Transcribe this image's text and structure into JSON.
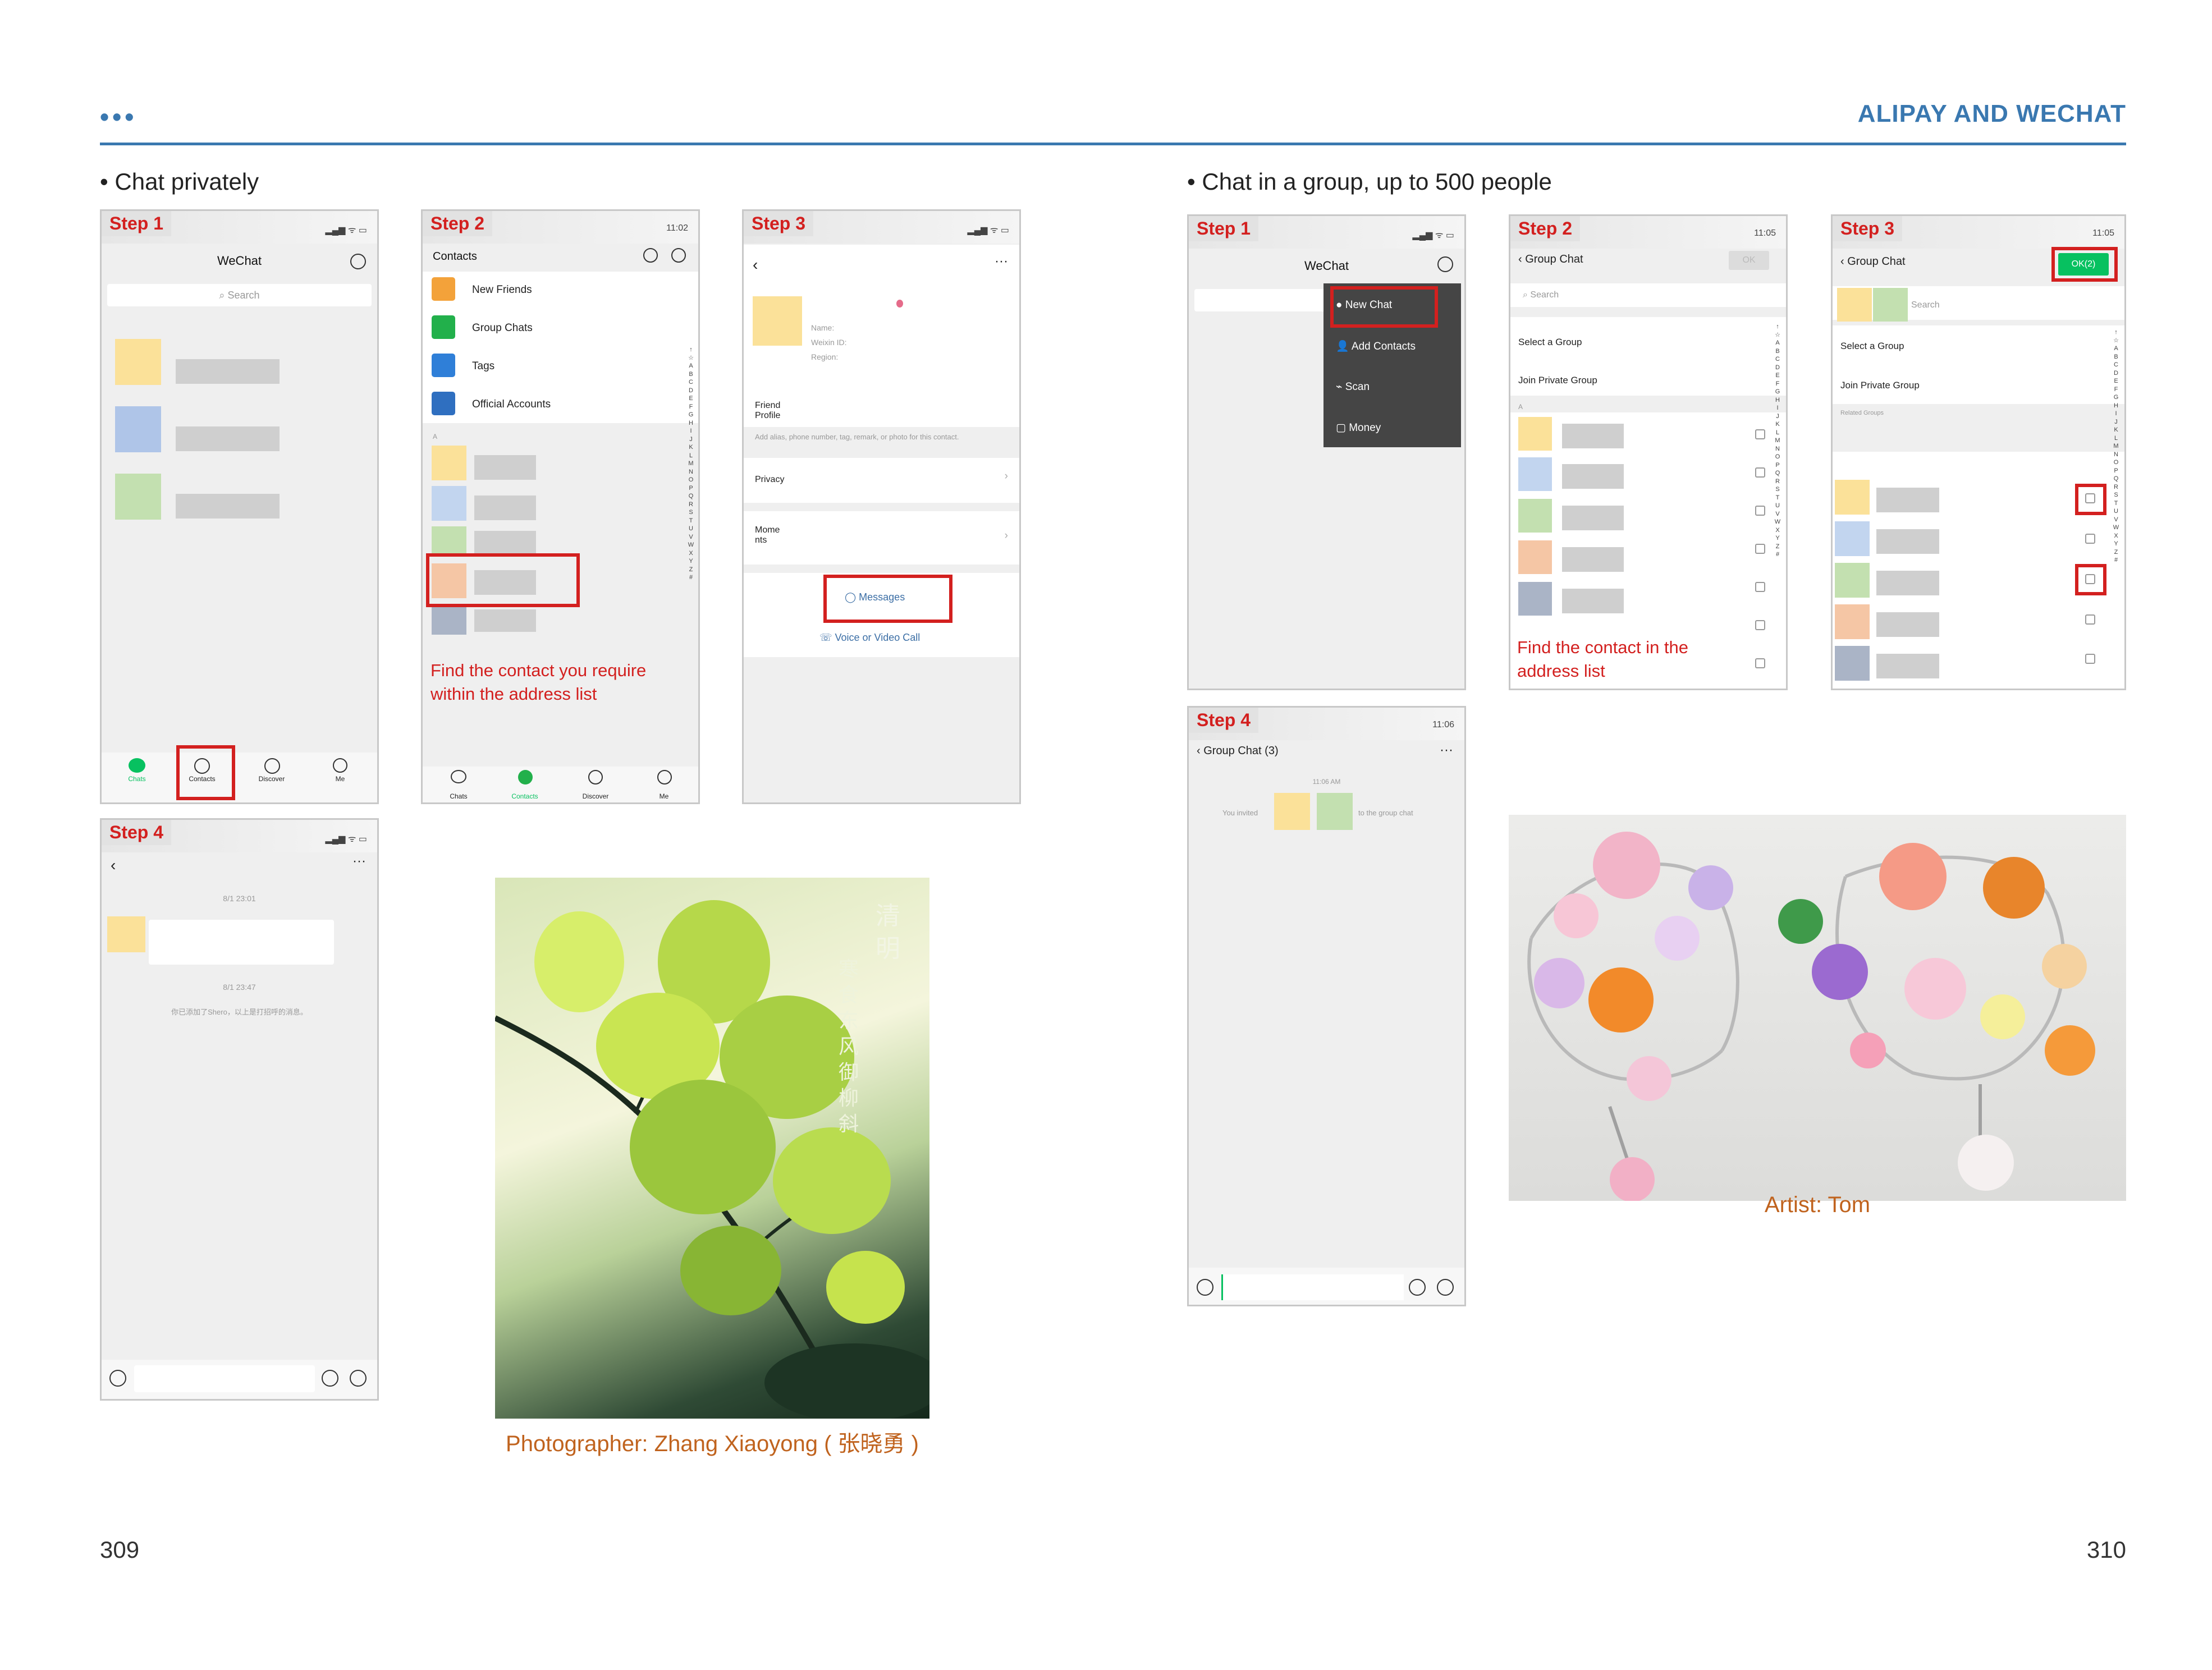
{
  "header": {
    "dots": "•••",
    "title": "ALIPAY AND WECHAT"
  },
  "left": {
    "section_title": "• Chat privately",
    "step1": {
      "step": "Step 1",
      "title": "WeChat",
      "search": "Search",
      "tabs": [
        "Chats",
        "Contacts",
        "Discover",
        "Me"
      ]
    },
    "step2": {
      "step": "Step 2",
      "time": "11:02",
      "title": "Contacts",
      "items": [
        "New Friends",
        "Group Chats",
        "Tags",
        "Official Accounts"
      ],
      "section_letter": "A",
      "note": "Find the contact you require within the address list",
      "tabs": [
        "Chats",
        "Contacts",
        "Discover",
        "Me"
      ]
    },
    "step3": {
      "step": "Step 3",
      "name_label": "Name:",
      "weixin_label": "Weixin ID:",
      "region_label": "Region:",
      "friend_profile": "Friend Profile",
      "friend_hint": "Add alias, phone number, tag, remark, or photo for this contact.",
      "privacy": "Privacy",
      "moments": "Mome nts",
      "messages": "Messages",
      "voice": "Voice or Video Call"
    },
    "step4": {
      "step": "Step 4",
      "time1": "8/1 23:01",
      "time2": "8/1 23:47",
      "system_msg": "你已添加了Shero，以上是打招呼的消息。"
    },
    "photo": {
      "vertical_text": "清 明",
      "vertical_text2": "寒食东风御柳斜",
      "caption": "Photographer: Zhang Xiaoyong ( 张晓勇 )"
    },
    "page_number": "309"
  },
  "right": {
    "section_title": "• Chat in a group, up to 500 people",
    "step1": {
      "step": "Step 1",
      "title": "WeChat",
      "menu": [
        "New Chat",
        "Add Contacts",
        "Scan",
        "Money"
      ]
    },
    "step2": {
      "step": "Step 2",
      "time": "11:05",
      "title": "Group Chat",
      "ok": "OK",
      "search": "Search",
      "select": "Select a Group",
      "join": "Join Private Group",
      "section_letter": "A",
      "note": "Find the contact in the address list"
    },
    "step3": {
      "step": "Step 3",
      "time": "11:05",
      "title": "Group Chat",
      "ok": "OK(2)",
      "search": "Search",
      "select": "Select a Group",
      "join": "Join Private Group",
      "related": "Related Groups"
    },
    "step4": {
      "step": "Step 4",
      "time": "11:06",
      "title": "Group Chat (3)",
      "msg_time": "11:06 AM",
      "you_invited": "You invited",
      "to_group": "to the group chat"
    },
    "photo": {
      "caption": "Artist: Tom"
    },
    "page_number": "310"
  },
  "alphabet": [
    "↑",
    "☆",
    "A",
    "B",
    "C",
    "D",
    "E",
    "F",
    "G",
    "H",
    "I",
    "J",
    "K",
    "L",
    "M",
    "N",
    "O",
    "P",
    "Q",
    "R",
    "S",
    "T",
    "U",
    "V",
    "W",
    "X",
    "Y",
    "Z",
    "#"
  ],
  "colors": {
    "accent": "#3a78b0",
    "step_red": "#d3201f",
    "wechat_green": "#07c160",
    "caption_orange": "#c0631e"
  }
}
